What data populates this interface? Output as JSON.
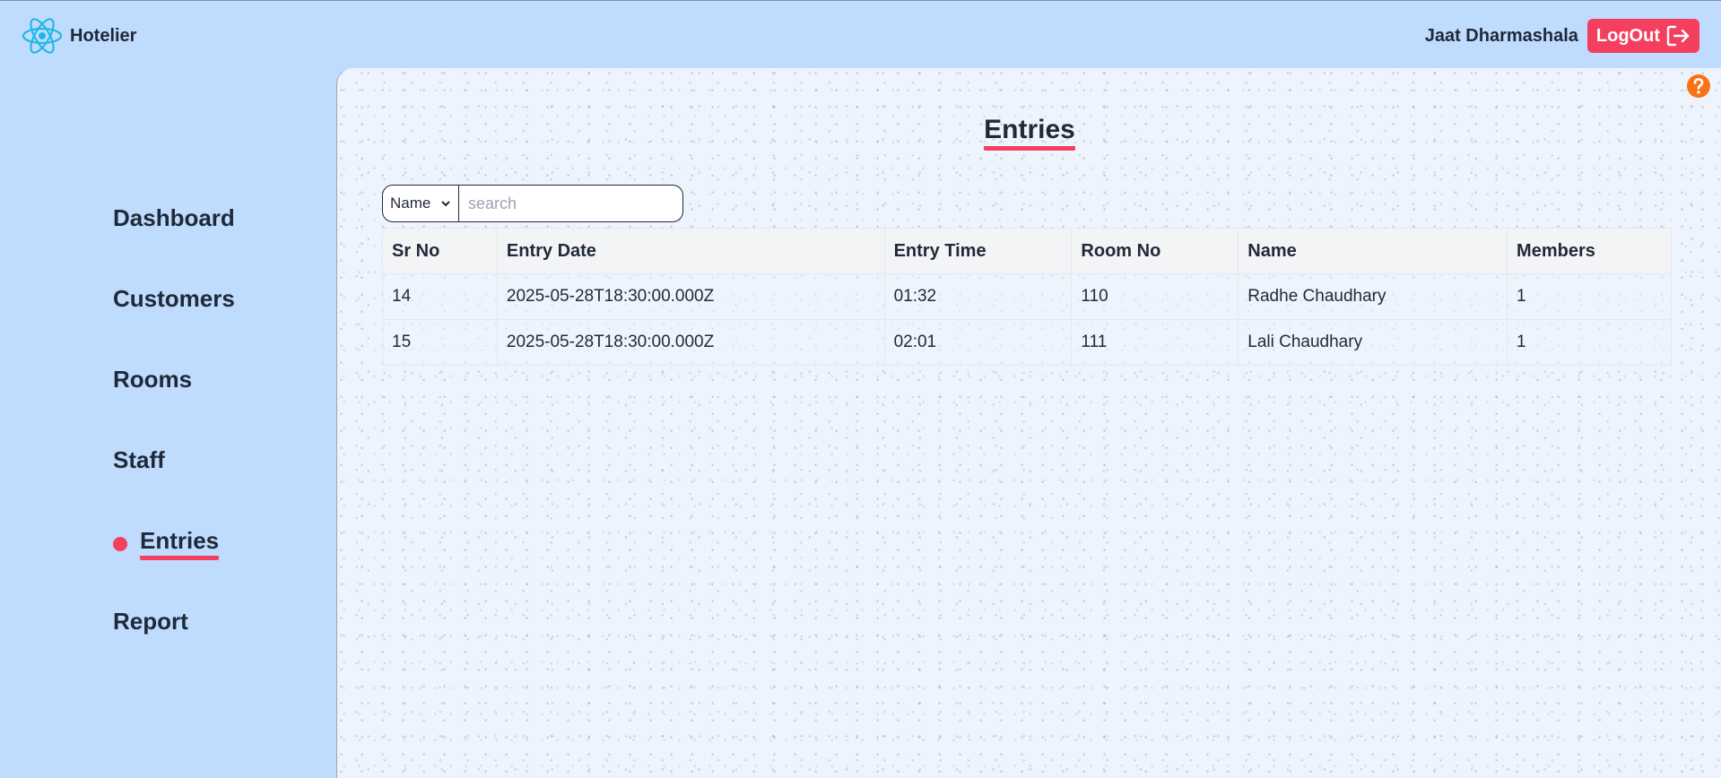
{
  "app": {
    "brand": "Hotelier",
    "user_name": "Jaat Dharmashala",
    "logout_label": "LogOut"
  },
  "sidebar": {
    "items": [
      {
        "label": "Dashboard",
        "active": false
      },
      {
        "label": "Customers",
        "active": false
      },
      {
        "label": "Rooms",
        "active": false
      },
      {
        "label": "Staff",
        "active": false
      },
      {
        "label": "Entries",
        "active": true
      },
      {
        "label": "Report",
        "active": false
      }
    ]
  },
  "main": {
    "title": "Entries",
    "search": {
      "filter_selected": "Name",
      "placeholder": "search",
      "value": ""
    },
    "table": {
      "columns": [
        "Sr No",
        "Entry Date",
        "Entry Time",
        "Room No",
        "Name",
        "Members"
      ],
      "rows": [
        [
          "14",
          "2025-05-28T18:30:00.000Z",
          "01:32",
          "110",
          "Radhe Chaudhary",
          "1"
        ],
        [
          "15",
          "2025-05-28T18:30:00.000Z",
          "02:01",
          "111",
          "Lali Chaudhary",
          "1"
        ]
      ]
    }
  },
  "colors": {
    "accent": "#f43f5e",
    "background": "#bfdbfe",
    "help": "#f97316",
    "logo": "#22b8e6"
  }
}
